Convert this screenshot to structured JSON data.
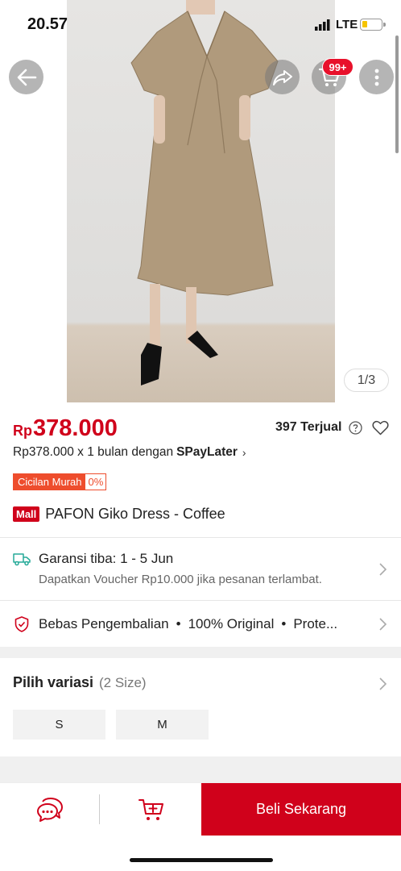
{
  "status_bar": {
    "time": "20.57",
    "network": "LTE"
  },
  "header": {
    "cart_badge": "99+",
    "image_counter": "1/3"
  },
  "product": {
    "price_currency": "Rp",
    "price_amount": "378.000",
    "sold": "397 Terjual",
    "paylater_prefix": "Rp378.000 x 1 bulan dengan",
    "paylater_brand": "SPayLater",
    "cicilan_label": "Cicilan Murah",
    "cicilan_rate": "0%",
    "mall_badge": "Mall",
    "title": "PAFON Giko Dress - Coffee"
  },
  "shipping": {
    "title": "Garansi tiba: 1 - 5 Jun",
    "subtitle": "Dapatkan Voucher Rp10.000 jika pesanan terlambat."
  },
  "guarantee": {
    "items": [
      "Bebas Pengembalian",
      "100% Original",
      "Prote..."
    ],
    "separator": "•"
  },
  "variation": {
    "title": "Pilih variasi",
    "count": "(2 Size)",
    "options": [
      "S",
      "M"
    ]
  },
  "bottom_bar": {
    "buy_label": "Beli Sekarang"
  },
  "colors": {
    "brand_red": "#d0011b",
    "orange": "#ee4d2d",
    "dress": "#b09a7c"
  }
}
